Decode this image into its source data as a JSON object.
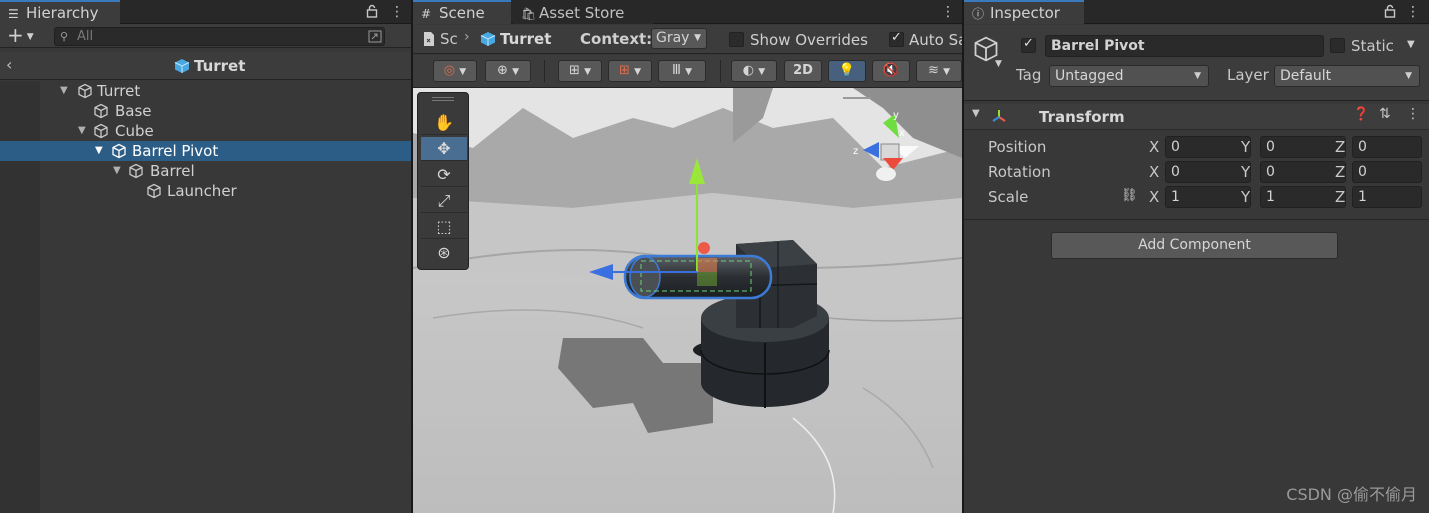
{
  "hierarchy": {
    "tab_label": "Hierarchy",
    "add_label": "+",
    "search_placeholder": "All",
    "breadcrumb": "Turret",
    "rows": [
      {
        "label": "Turret",
        "depth": 0,
        "expanded": true,
        "selected": false
      },
      {
        "label": "Base",
        "depth": 1,
        "expanded": null,
        "selected": false
      },
      {
        "label": "Cube",
        "depth": 1,
        "expanded": true,
        "selected": false
      },
      {
        "label": "Barrel Pivot",
        "depth": 2,
        "expanded": true,
        "selected": true
      },
      {
        "label": "Barrel",
        "depth": 3,
        "expanded": true,
        "selected": false
      },
      {
        "label": "Launcher",
        "depth": 4,
        "expanded": null,
        "selected": false
      }
    ]
  },
  "scene": {
    "tab_label": "Scene",
    "asset_store_label": "Asset Store",
    "breadcrumb_root": "Sc",
    "breadcrumb_prefab": "Turret",
    "context_label": "Context:",
    "context_value": "Gray",
    "show_overrides_label": "Show Overrides",
    "auto_save_label": "Auto Sa",
    "mode_2d_label": "2D"
  },
  "inspector": {
    "tab_label": "Inspector",
    "object_name": "Barrel Pivot",
    "static_label": "Static",
    "tag_label": "Tag",
    "tag_value": "Untagged",
    "layer_label": "Layer",
    "layer_value": "Default",
    "component_title": "Transform",
    "position_label": "Position",
    "rotation_label": "Rotation",
    "scale_label": "Scale",
    "axis_x": "X",
    "axis_y": "Y",
    "axis_z": "Z",
    "position": {
      "x": "0",
      "y": "0",
      "z": "0"
    },
    "rotation": {
      "x": "0",
      "y": "0",
      "z": "0"
    },
    "scale": {
      "x": "1",
      "y": "1",
      "z": "1"
    },
    "add_component_label": "Add Component"
  },
  "watermark": "CSDN @偷不偷月",
  "colors": {
    "selection": "#2c5d87",
    "accent": "#3a79bb",
    "panel": "#383838"
  }
}
